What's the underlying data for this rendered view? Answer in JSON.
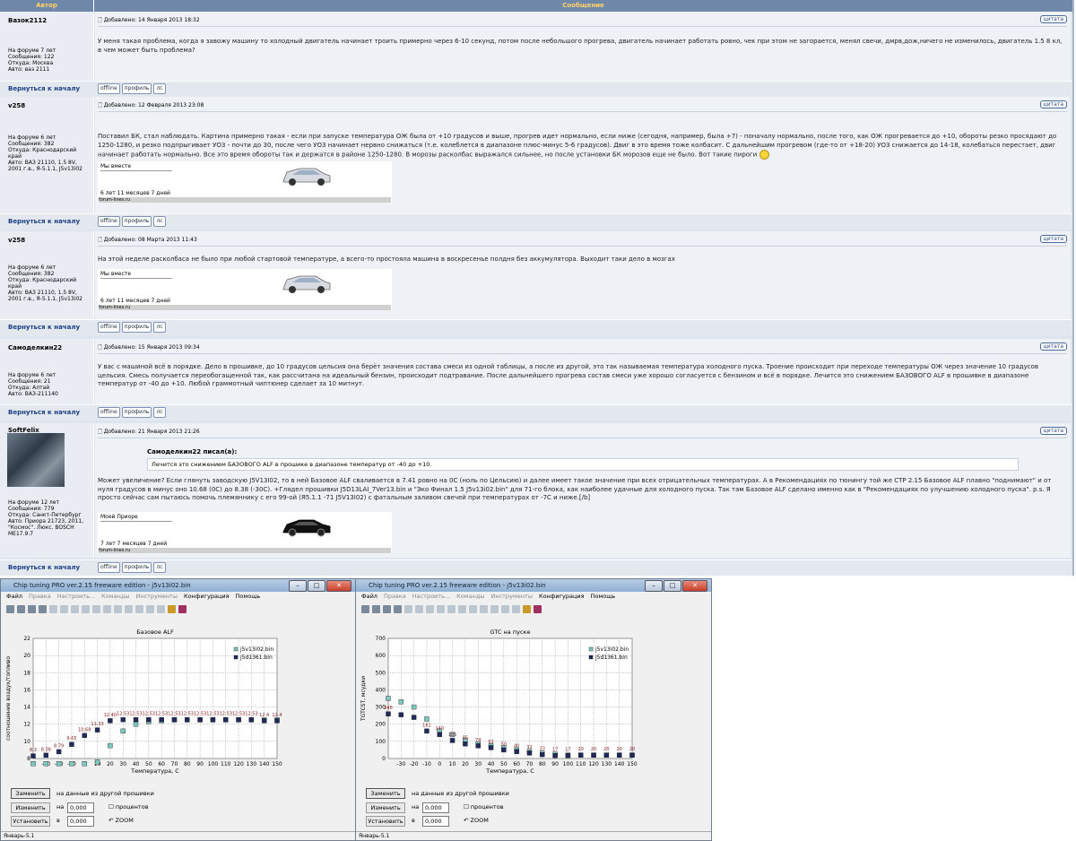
{
  "header": {
    "author_col": "Автор",
    "message_col": "Сообщение"
  },
  "common": {
    "back": "Вернуться к началу",
    "offline": "offline",
    "profile": "профиль",
    "pm": "лс",
    "quote": "цитата"
  },
  "posts": [
    {
      "author": "Вазок2112",
      "info": [
        "На форуме 7 лет",
        "Сообщения: 122",
        "Откуда: Москва",
        "Авто: ваз 2111"
      ],
      "date": "Добавлено: 14 Января 2013 18:32",
      "text": "У меня такая проблема, когда я завожу машину то холодный двигатель начинает троить примерно через 6-10 секунд, потом после небольшого прогрева, двигатель начинает работать ровно, чек при этом не загорается, менял свечи, дмрв,дож,ничего не изменилось, двигатель 1.5 8 кл, в чем может быть проблема?"
    },
    {
      "author": "v258",
      "info": [
        "На форуме 6 лет",
        "Сообщения: 382",
        "Откуда: Краснодарский край",
        "Авто: ВАЗ 21110, 1.5 8V, 2001 г.в., Я-5.1.1, J5v13i02"
      ],
      "date": "Добавлено: 12 Февраля 2013 23:08",
      "text": "Поставил БК, стал наблюдать. Картина примерно такая - если при запуске температура ОЖ была от +10 градусов и выше, прогрев идет нормально, если ниже (сегодня, например, была +7) - поначалу нормально, после того, как ОЖ прогревается до +10, обороты резко просядают до 1250-1280, и резко подпрыгивает УОЗ - почти до 30, после чего УОЗ начинает нервно снижаться (т.е. колеблется в диапазоне плюс-минус 5-6 градусов). Двиг в это время тоже колбасит. С дальнейшим прогревом (где-то от +18-20) УОЗ снижается до 14-18, колебаться перестает, двиг начинает работать нормально. Все это время обороты так и держатся в районе 1250-1280. В морозы расколбас выражался сильнее, но после установки БК морозов еще не было. Вот такие пироги",
      "sig": {
        "line1": "Мы вместе",
        "line2": "6 лет 11 месяцев 7 дней",
        "site": "forum-lines.ru"
      }
    },
    {
      "author": "v258",
      "info": [
        "На форуме 6 лет",
        "Сообщения: 382",
        "Откуда: Краснодарский край",
        "Авто: ВАЗ 21110, 1.5 8V, 2001 г.в., Я-5.1.1, J5v13i02"
      ],
      "date": "Добавлено: 08 Марта 2013 11:43",
      "text": "На этой неделе расколбаса не было при любой стартовой температуре, а всего-то простояла машина в воскресенье полдня без аккумулятора. Выходит таки дело в мозгах",
      "sig": {
        "line1": "Мы вместе",
        "line2": "6 лет 11 месяцев 7 дней",
        "site": "forum-lines.ru"
      }
    },
    {
      "author": "Самоделкин22",
      "info": [
        "На форуме 6 лет",
        "Сообщения: 21",
        "Откуда: Алтай",
        "Авто: ВАЗ-211140"
      ],
      "date": "Добавлено: 15 Января 2013 09:34",
      "text": "У вас с машиной всё в порядке. Дело в прошивке, до 10 градусов цельсия она берёт значения состава смеси из одной таблицы, а после из другой, это так называемая температура холодного пуска. Троение происходит при переходе температуры ОЖ через значение 10 градусов цельсия. Смесь получается переобогащенной так, как рассчитана на идеальный бензин, происходит подтравание. После дальнейшего прогрева состав смеси уже хорошо согласуется с бензином и всё в порядке. Лечится это снижением БАЗОВОГО ALF в прошивке в диапазоне температур от -40 до +10. Любой граммотный чиптюнер сделает за 10 митнут."
    },
    {
      "author": "SoftFelix",
      "info": [
        "На форуме 12 лет",
        "Сообщения: 779",
        "Откуда: Санкт-Петербург",
        "Авто: Приора 21723, 2011, \"Космос\". Люкс. BOSCH ME17.9.7"
      ],
      "date": "Добавлено: 21 Января 2013 21:26",
      "quote_title": "Самоделкин22 писал(а):",
      "quote_text": "Лечится это снижением БАЗОВОГО ALF в прошике в диапазоне температур от -40 до +10.",
      "text": "Может увеличение? Если глянуть заводскую J5V13I02, то в ней Базовое ALF сваливается в 7.41 ровно на 0С (ноль по Цельсию) и далее имеет такое значение при всех отрицательных температурах. А в Рекомендациях по тюнингу той же CTP 2.15 Базовое ALF плавно \"поднимают\" и от нуля градусов в минус оно 10.68 (0С) до 8.38 (-30С). +Глядел прошивки J5D13LAI_7Ver13.bin и \"Эко Финал 1.5 J5v13i02.bin\" для 71-го блока, как наиболее удачные для холодного пуска. Так там Базовое ALF сделано именно как в \"Рекомендациях по улучшению холодного пуска\". p.s. Я просто сейчас сам пытаюсь помочь племяннику с его 99-ой (Я5.1.1 -71 J5V13I02) с фатальным заливом свечей при температурах от -7С и ниже.[/b]",
      "sig": {
        "line1": "Моей Приоре",
        "line2": "7 лет 7 месяцев 7 дней",
        "site": "forum-lines.ru"
      }
    }
  ],
  "windows": [
    {
      "title": "Chip tuning PRO ver.2.15 freeware edition - j5v13i02.bin",
      "menu": [
        "Файл",
        "Правка",
        "Настроить...",
        "Команды",
        "Инструменты",
        "Конфигурация",
        "Помощь"
      ],
      "replace": "Заменить",
      "replace_text": "на данные из другой прошивки",
      "change": "Изменить",
      "on": "на",
      "install": "Установить",
      "in": "в",
      "val": "0,000",
      "percent": "процентов",
      "zoom": "ZOOM",
      "status": "Январь-5.1"
    },
    {
      "title": "Chip tuning PRO ver.2.15 freeware edition - j5v13i02.bin",
      "menu": [
        "Файл",
        "Правка",
        "Настроить...",
        "Команды",
        "Инструменты",
        "Конфигурация",
        "Помощь"
      ],
      "replace": "Заменить",
      "replace_text": "на данные из другой прошивки",
      "change": "Изменить",
      "on": "на",
      "install": "Установить",
      "in": "в",
      "val": "0,000",
      "percent": "процентов",
      "zoom": "ZOOM",
      "status": "Январь-5.1"
    }
  ],
  "chart_data": [
    {
      "type": "scatter",
      "title": "Базовое ALF",
      "xlabel": "Температура, С",
      "ylabel": "соотношение воздух/топливо",
      "xlim": [
        -40,
        150
      ],
      "ylim": [
        8,
        22
      ],
      "x": [
        -40,
        -30,
        -20,
        -10,
        0,
        10,
        20,
        30,
        40,
        50,
        60,
        70,
        80,
        90,
        100,
        110,
        120,
        130,
        140,
        150
      ],
      "series": [
        {
          "name": "j5v13i02.bin",
          "color": "#7fc8c0",
          "values": [
            7.4,
            7.4,
            7.4,
            7.4,
            7.4,
            7.6,
            9.5,
            11.2,
            12.0,
            12.3,
            12.4,
            12.5,
            12.5,
            12.5,
            12.5,
            12.5,
            12.5,
            12.5,
            12.5,
            12.5
          ]
        },
        {
          "name": "j5d1361.bin",
          "color": "#1f2a5a",
          "values": [
            8.3,
            8.38,
            8.79,
            9.65,
            10.68,
            11.33,
            12.4,
            12.53,
            12.53,
            12.53,
            12.53,
            12.53,
            12.53,
            12.53,
            12.53,
            12.53,
            12.53,
            12.53,
            12.4,
            12.4
          ]
        }
      ],
      "labels": [
        "8.3",
        "8.38",
        "8.79",
        "9.65",
        "10.68",
        "11.33",
        "12.40",
        "12.53",
        "12.53",
        "12.53",
        "12.53",
        "12.53",
        "12.53",
        "12.53",
        "12.53",
        "12.53",
        "12.53",
        "12.53",
        "12.4",
        "12.4"
      ],
      "yticks": [
        8,
        10,
        12,
        14,
        16,
        18,
        20,
        22
      ],
      "xticks": [
        -30,
        -20,
        -10,
        0,
        10,
        20,
        30,
        40,
        50,
        60,
        70,
        80,
        90,
        100,
        110,
        120,
        130,
        140,
        150
      ]
    },
    {
      "type": "scatter",
      "title": "GTC на пуске",
      "xlabel": "Температура, С",
      "ylabel": "TGTCST, мсудки",
      "xlim": [
        -40,
        150
      ],
      "ylim": [
        0,
        700
      ],
      "x": [
        -40,
        -30,
        -20,
        -10,
        0,
        10,
        20,
        30,
        40,
        50,
        60,
        70,
        80,
        90,
        100,
        110,
        120,
        130,
        140,
        150
      ],
      "series": [
        {
          "name": "j5v13i02.bin",
          "color": "#7fc8c0",
          "values": [
            350,
            330,
            300,
            230,
            160,
            140,
            105,
            85,
            74,
            63,
            50,
            40,
            30,
            25,
            20,
            20,
            20,
            20,
            20,
            20
          ]
        },
        {
          "name": "j5d1361.bin",
          "color": "#1f2a5a",
          "values": [
            260,
            255,
            240,
            160,
            140,
            105,
            85,
            74,
            63,
            50,
            40,
            32,
            23,
            17,
            17,
            20,
            20,
            20,
            20,
            20
          ]
        }
      ],
      "labels": [
        "248",
        "",
        "",
        "161",
        "140",
        "105",
        "85",
        "74",
        "63",
        "50",
        "40",
        "32",
        "23",
        "17",
        "17",
        "20",
        "20",
        "20",
        "20",
        "20"
      ],
      "yticks": [
        0,
        100,
        200,
        300,
        400,
        500,
        600,
        700
      ],
      "xticks": [
        -30,
        -20,
        -10,
        0,
        10,
        20,
        30,
        40,
        50,
        60,
        70,
        80,
        90,
        100,
        110,
        120,
        130,
        140,
        150
      ]
    }
  ]
}
